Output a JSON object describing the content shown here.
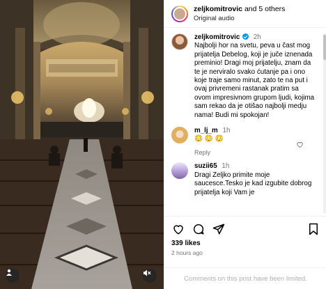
{
  "header": {
    "username": "zeljkomitrovic",
    "and_others": "and 5 others",
    "audio": "Original audio"
  },
  "caption": {
    "username": "zeljkomitrovic",
    "time": "2h",
    "text": "Najbolji hor na svetu, peva u čast mog prijatelja Debelog, koji je juče iznenada preminio! Dragi moj prijatelju, znam da te je nerviralo svako ćutanje pa i ono koje traje samo minut, zato te na put i ovaj privremeni rastanak pratim sa ovom impresivnom grupom ljudi, kojima sam rekao da je otišao najbolji medju nama! Budi mi spokojan!"
  },
  "comments": [
    {
      "username": "m_lj_m",
      "time": "1h",
      "text": "😳 😳 😳",
      "reply_label": "Reply"
    },
    {
      "username": "suzii65",
      "time": "1h",
      "text": "Dragi Zeljko primite moje saucesce.Tesko je kad izgubite dobrog prijatelja koji Vam je"
    }
  ],
  "stats": {
    "likes": "339 likes",
    "posted": "2 hours ago"
  },
  "footer": {
    "limited_text": "Comments on this post have been limited."
  },
  "icons": {
    "like": "heart-icon",
    "comment": "comment-icon",
    "share": "share-icon",
    "save": "bookmark-icon",
    "mute": "muted-speaker-icon",
    "tags": "user-tag-icon"
  }
}
